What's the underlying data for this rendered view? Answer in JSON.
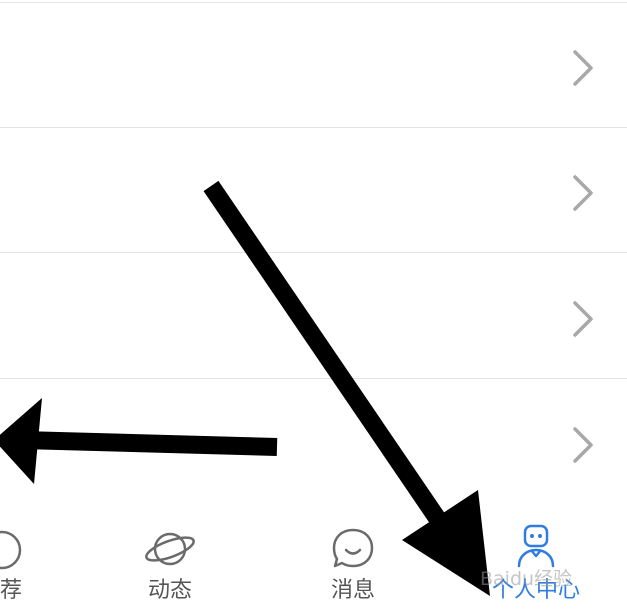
{
  "list": {
    "rows": [
      {
        "chevron_icon": "chevron-right-icon"
      },
      {
        "chevron_icon": "chevron-right-icon"
      },
      {
        "chevron_icon": "chevron-right-icon"
      },
      {
        "chevron_icon": "chevron-right-icon"
      }
    ]
  },
  "tabbar": {
    "tabs": [
      {
        "label": "荐",
        "icon": "recommend-icon",
        "active": false
      },
      {
        "label": "动态",
        "icon": "planet-icon",
        "active": false
      },
      {
        "label": "消息",
        "icon": "chat-bubble-icon",
        "active": false
      },
      {
        "label": "个人中心",
        "icon": "profile-robot-icon",
        "active": true
      }
    ]
  },
  "watermark": {
    "text": "Baidu经验"
  },
  "colors": {
    "accent": "#2f7de1",
    "tab_text": "#555555",
    "chevron": "#a8a8a8",
    "divider": "#e3e3e3",
    "arrow": "#000000"
  }
}
